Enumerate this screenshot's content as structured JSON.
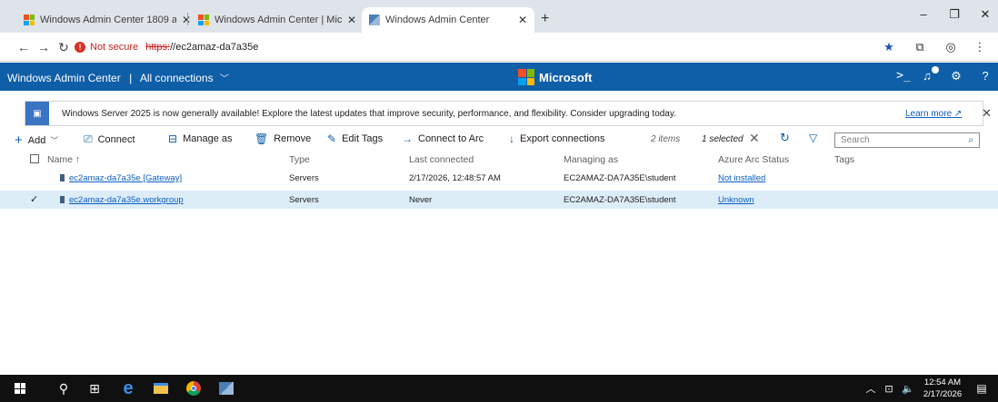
{
  "browser": {
    "tabs": [
      {
        "title": "Windows Admin Center 1809 ar",
        "active": false,
        "favicon": "microsoft-logo"
      },
      {
        "title": "Windows Admin Center | Micro",
        "active": false,
        "favicon": "microsoft-logo"
      },
      {
        "title": "Windows Admin Center",
        "active": true,
        "favicon": "server-manager-icon"
      }
    ],
    "new_tab": "+",
    "security_text": "Not secure",
    "url_scheme": "https:",
    "url_rest": "//ec2amaz-da7a35e"
  },
  "wac": {
    "title": "Windows Admin Center",
    "separator": "|",
    "connections_label": "All connections",
    "brand": "Microsoft",
    "header_icons": [
      "terminal-icon",
      "notifications-icon",
      "settings-icon",
      "help-icon"
    ]
  },
  "banner": {
    "text": "Windows Server 2025 is now generally available! Explore the latest updates that improve security, performance, and flexibility. Consider upgrading today.",
    "link": "Learn more"
  },
  "toolbar": {
    "add": "Add",
    "connect": "Connect",
    "manage_as": "Manage as",
    "remove": "Remove",
    "edit_tags": "Edit Tags",
    "connect_to_arc": "Connect to Arc",
    "export": "Export connections",
    "items_count": "2 items",
    "selected_count": "1 selected",
    "search_placeholder": "Search"
  },
  "table": {
    "columns": [
      "Name ↑",
      "Type",
      "Last connected",
      "Managing as",
      "Azure Arc Status",
      "Tags"
    ],
    "rows": [
      {
        "name": "ec2amaz-da7a35e [Gateway]",
        "type": "Servers",
        "last_connected": "2/17/2026, 12:48:57 AM",
        "managing_as": "EC2AMAZ-DA7A35E\\student",
        "arc_status": "Not installed",
        "tags": "",
        "selected": false
      },
      {
        "name": "ec2amaz-da7a35e.workgroup",
        "type": "Servers",
        "last_connected": "Never",
        "managing_as": "EC2AMAZ-DA7A35E\\student",
        "arc_status": "Unknown",
        "tags": "",
        "selected": true
      }
    ]
  },
  "taskbar": {
    "time": "12:54 AM",
    "date": "2/17/2026"
  },
  "colors": {
    "header_blue": "#0f5ea8",
    "link_blue": "#0b5fc2",
    "selected_row": "#dcedf8",
    "not_secure_red": "#c5221f"
  }
}
